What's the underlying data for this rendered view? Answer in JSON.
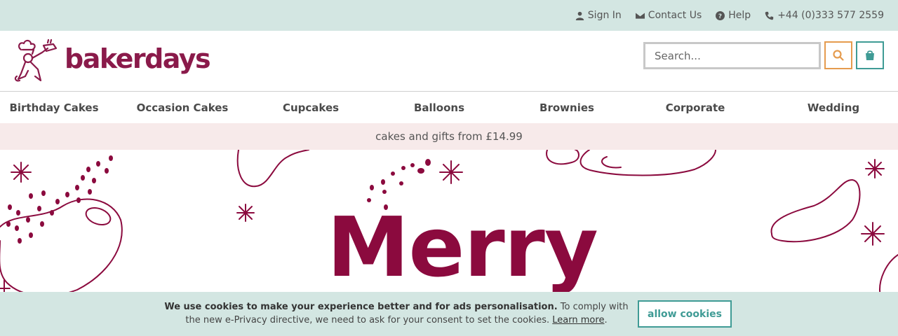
{
  "topbar": {
    "sign_in": "Sign In",
    "contact_us": "Contact Us",
    "help": "Help",
    "phone": "+44 (0)333 577 2559"
  },
  "header": {
    "brand": "bakerdays",
    "search_placeholder": "Search...",
    "search_icon": "search-icon",
    "cart_icon": "shopping-bag-icon"
  },
  "nav": {
    "items": [
      "Birthday Cakes",
      "Occasion Cakes",
      "Cupcakes",
      "Balloons",
      "Brownies",
      "Corporate",
      "Wedding"
    ]
  },
  "promo": {
    "text": "cakes and gifts from £14.99"
  },
  "hero": {
    "headline": "Merry"
  },
  "cookie": {
    "bold": "We use cookies to make your experience better and for ads personalisation.",
    "text": " To comply with the new e-Privacy directive, we need to ask for your consent to set the cookies. ",
    "learn_more": "Learn more",
    "period": ".",
    "button": "allow cookies"
  },
  "colors": {
    "brand": "#8a1a4a",
    "topbar_bg": "#d3e6e2",
    "promo_bg": "#f7eaea",
    "accent_teal": "#3f9b95",
    "accent_orange": "#e59b4e"
  }
}
